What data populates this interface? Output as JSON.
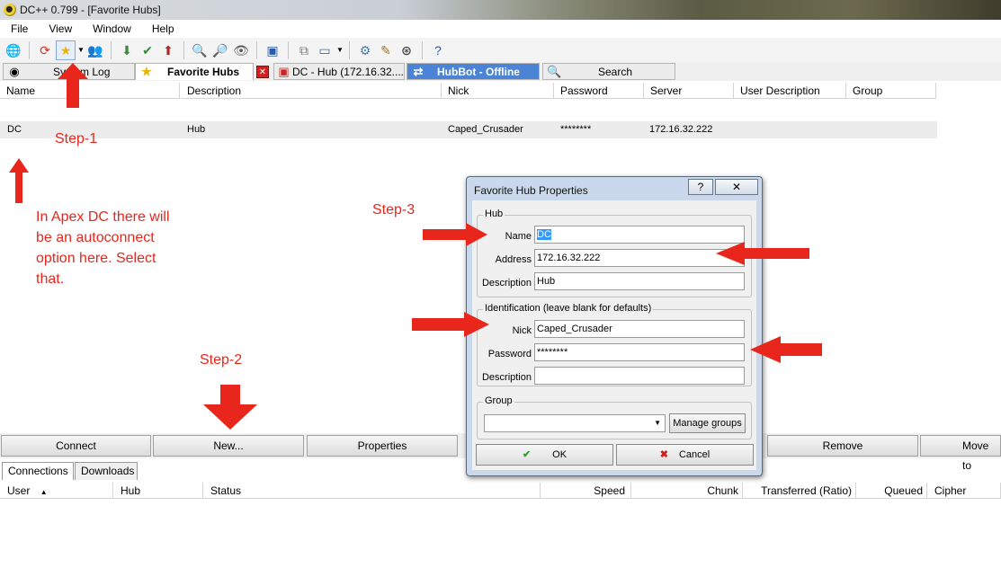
{
  "window": {
    "title": "DC++ 0.799 - [Favorite Hubs]"
  },
  "menu": [
    "File",
    "View",
    "Window",
    "Help"
  ],
  "tabs": [
    {
      "label": "System Log"
    },
    {
      "label": "Favorite Hubs"
    },
    {
      "label": "DC - Hub (172.16.32...."
    },
    {
      "label": "HubBot - Offline"
    },
    {
      "label": "Search"
    }
  ],
  "columns": [
    "Name",
    "Description",
    "Nick",
    "Password",
    "Server",
    "User Description",
    "Group"
  ],
  "hub": {
    "name": "DC",
    "description": "Hub",
    "nick": "Caped_Crusader",
    "password": "********",
    "server": "172.16.32.222"
  },
  "buttons": [
    "Connect",
    "New...",
    "Properties",
    "Remove",
    "Move to"
  ],
  "lower_tabs": [
    "Connections",
    "Downloads"
  ],
  "lower_columns": [
    "User",
    "Hub",
    "Status",
    "Speed",
    "Chunk",
    "Transferred (Ratio)",
    "Queued",
    "Cipher"
  ],
  "annotations": {
    "step1": "Step-1",
    "step2": "Step-2",
    "step3": "Step-3",
    "note_line1": "In Apex DC there will",
    "note_line2": "be an autoconnect",
    "note_line3": "option here. Select",
    "note_line4": "that."
  },
  "dialog": {
    "title": "Favorite Hub Properties",
    "help_btn": "?",
    "close_btn": "✕",
    "hub_group": "Hub",
    "name_label": "Name",
    "name_value": "DC",
    "address_label": "Address",
    "address_value": "172.16.32.222",
    "description_label": "Description",
    "description_value": "Hub",
    "ident_group": "Identification (leave blank for defaults)",
    "nick_label": "Nick",
    "nick_value": "Caped_Crusader",
    "password_label": "Password",
    "password_value": "********",
    "ident_desc_label": "Description",
    "ident_desc_value": "",
    "group_group": "Group",
    "group_value": "",
    "manage_groups": "Manage groups",
    "ok": "OK",
    "cancel": "Cancel"
  },
  "colors": {
    "annotation": "#e8261c",
    "hubbot_tab": "#4b84d6",
    "dialog_frame": "#c9d8ea"
  },
  "icons": [
    "app-icon",
    "globe-icon",
    "refresh-icon",
    "star-icon",
    "users-icon",
    "queue-icon",
    "finished-icon",
    "upload-icon",
    "search-icon",
    "adl-search-icon",
    "spy-icon",
    "notepad-icon",
    "net-stats-icon",
    "settings-icon",
    "about-icon"
  ]
}
